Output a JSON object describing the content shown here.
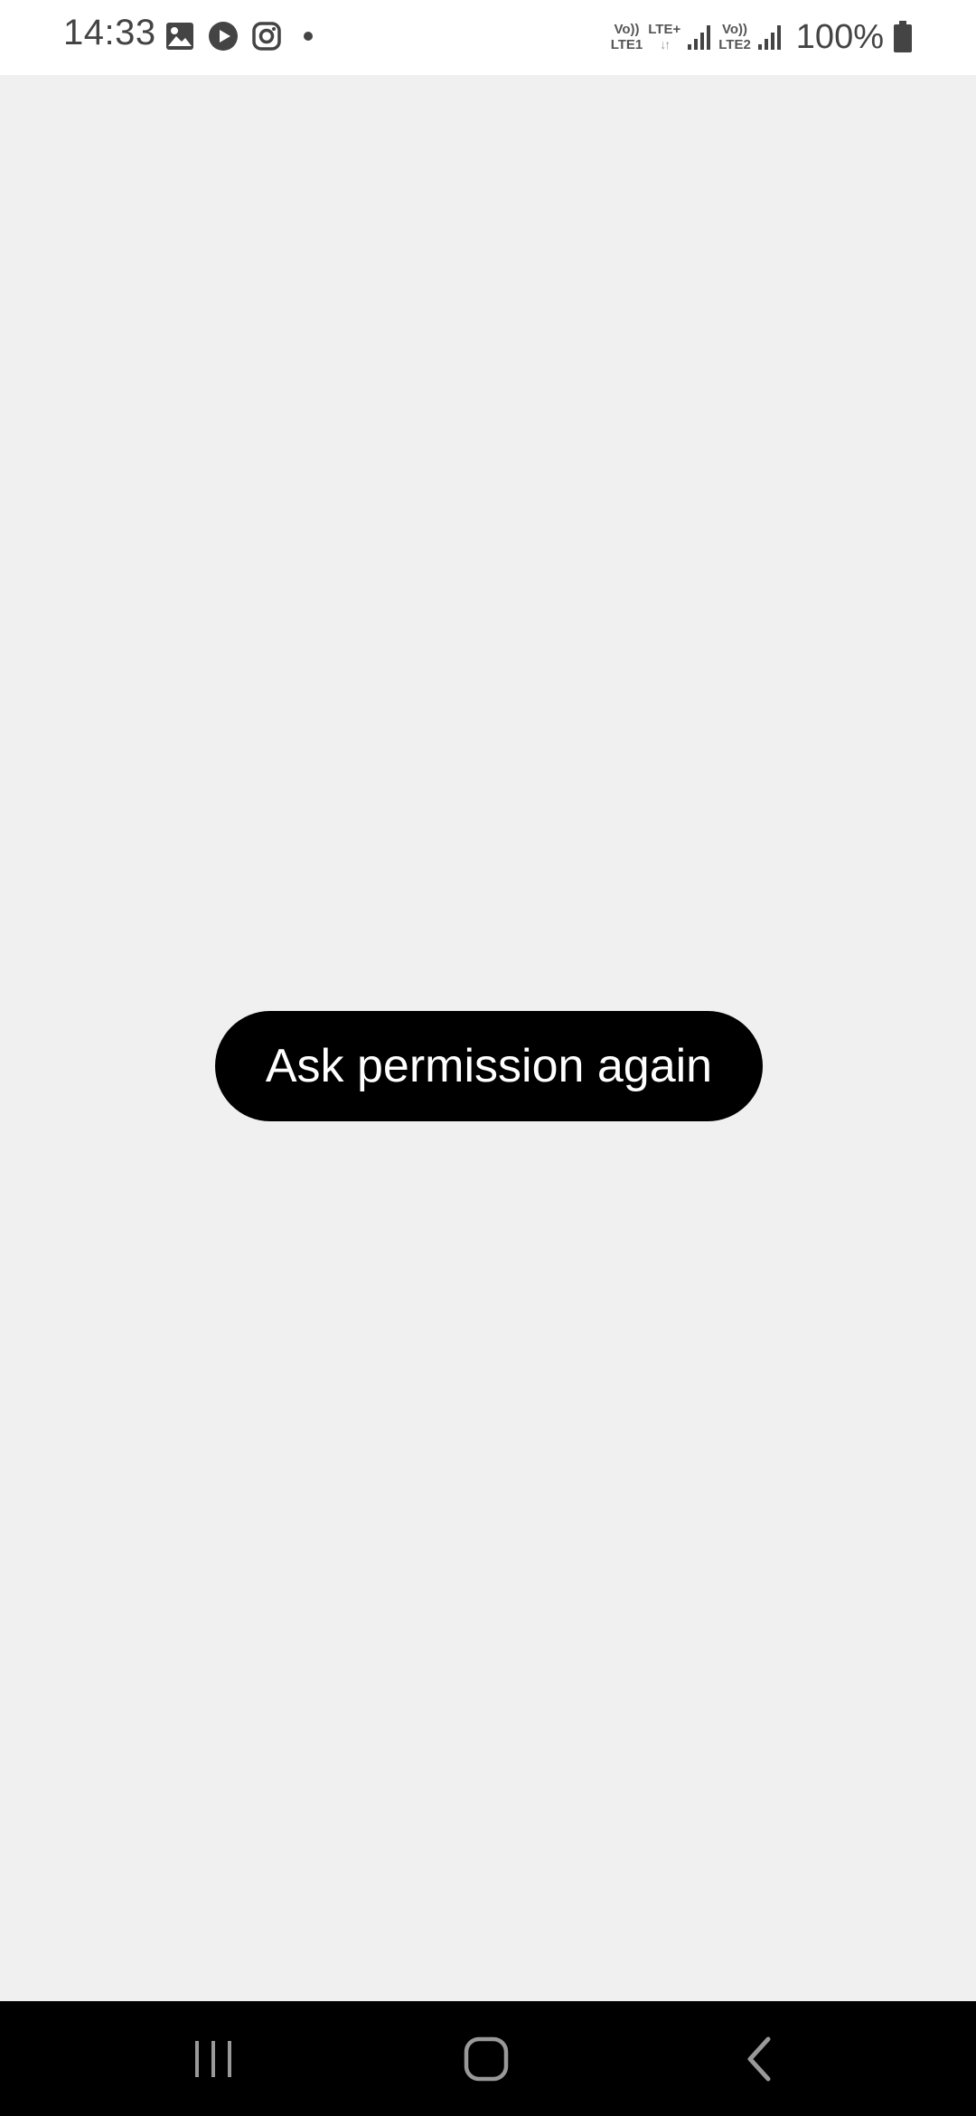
{
  "status_bar": {
    "time": "14:33",
    "notification_icons": [
      "gallery-icon",
      "youtube-icon",
      "instagram-icon",
      "more-dot-icon"
    ],
    "sim1": {
      "top": "Vo))",
      "bottom": "LTE1"
    },
    "network_type": "LTE+",
    "sim2": {
      "top": "Vo))",
      "bottom": "LTE2"
    },
    "battery": "100%"
  },
  "main": {
    "ask_button_label": "Ask permission again",
    "background_color": "#f0f0f0",
    "button_color": "#000000"
  },
  "nav_bar": {
    "buttons": [
      "recent-apps-icon",
      "home-icon",
      "back-icon"
    ]
  }
}
